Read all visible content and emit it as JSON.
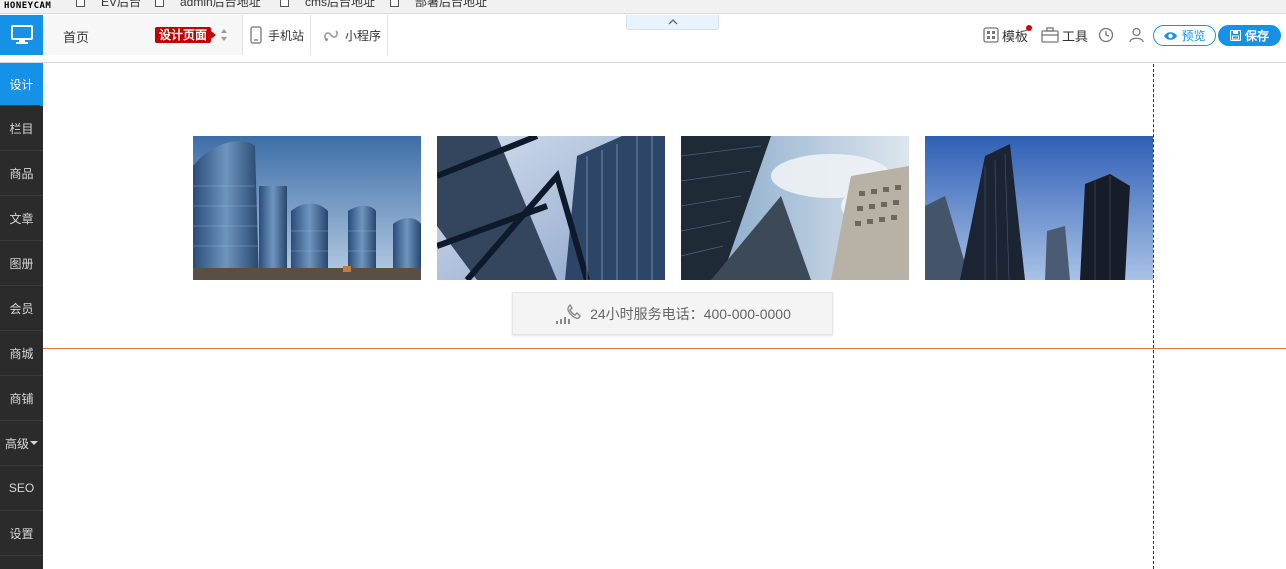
{
  "bookmarks": {
    "logo_text": "HONEYCAM",
    "items": [
      "EV后台",
      "admin后台地址",
      "cms后台地址",
      "部署后台地址"
    ]
  },
  "toolbar": {
    "home_label": "首页",
    "page_badge": "设计页面",
    "mobile_label": "手机站",
    "miniprogram_label": "小程序",
    "template_label": "模板",
    "tools_label": "工具",
    "preview_label": "预览",
    "save_label": "保存"
  },
  "sidebar": {
    "items": [
      {
        "label": "设计",
        "active": true
      },
      {
        "label": "栏目"
      },
      {
        "label": "商品"
      },
      {
        "label": "文章"
      },
      {
        "label": "图册"
      },
      {
        "label": "会员"
      },
      {
        "label": "商城"
      },
      {
        "label": "商铺"
      },
      {
        "label": "高级",
        "has_caret": true
      },
      {
        "label": "SEO"
      },
      {
        "label": "设置"
      }
    ],
    "add_symbol": "+"
  },
  "canvas": {
    "phone_text": "24小时服务电话：400-000-0000"
  },
  "colors": {
    "accent": "#1591e8",
    "sidebar_bg": "#2b2b2b",
    "badge": "#c40000",
    "guide_line": "#e07b39"
  }
}
